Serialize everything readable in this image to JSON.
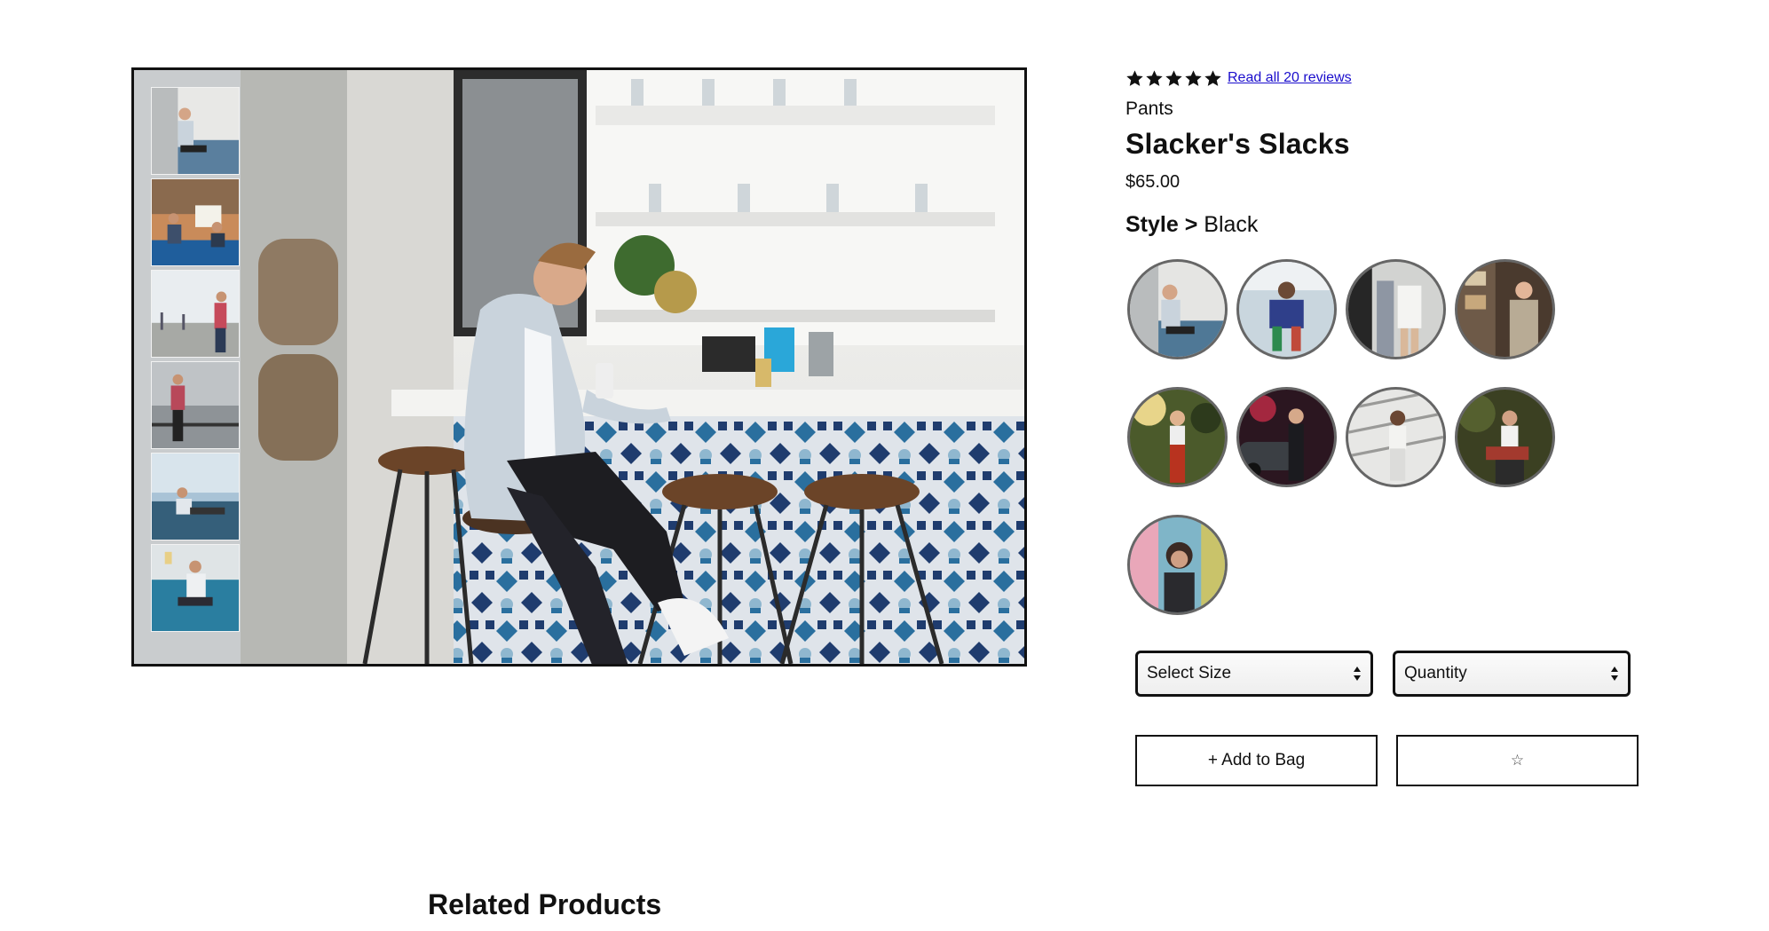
{
  "product": {
    "rating_stars": 5,
    "reviews_link": "Read all 20 reviews",
    "category": "Pants",
    "name": "Slacker's Slacks",
    "price": "$65.00",
    "style_label": "Style >",
    "style_value": "Black"
  },
  "gallery": {
    "thumbnail_count": 6,
    "thumbnails": [
      {
        "icon": "photo-man-at-bar"
      },
      {
        "icon": "photo-men-in-office"
      },
      {
        "icon": "photo-man-on-rooftop"
      },
      {
        "icon": "photo-man-on-balcony"
      },
      {
        "icon": "photo-man-on-couch"
      },
      {
        "icon": "photo-man-on-blue-sofa"
      }
    ]
  },
  "styles": {
    "swatch_count": 9,
    "items": [
      {
        "icon": "style-photo-1"
      },
      {
        "icon": "style-photo-2"
      },
      {
        "icon": "style-photo-3"
      },
      {
        "icon": "style-photo-4"
      },
      {
        "icon": "style-photo-5"
      },
      {
        "icon": "style-photo-6"
      },
      {
        "icon": "style-photo-7"
      },
      {
        "icon": "style-photo-8"
      },
      {
        "icon": "style-photo-9"
      }
    ]
  },
  "controls": {
    "size_select": "Select Size",
    "quantity_select": "Quantity",
    "add_to_bag": "+ Add to Bag",
    "favorite": "☆"
  },
  "related": {
    "heading": "Related Products"
  },
  "colors": {
    "link": "#1a0dcc",
    "border": "#111111"
  }
}
